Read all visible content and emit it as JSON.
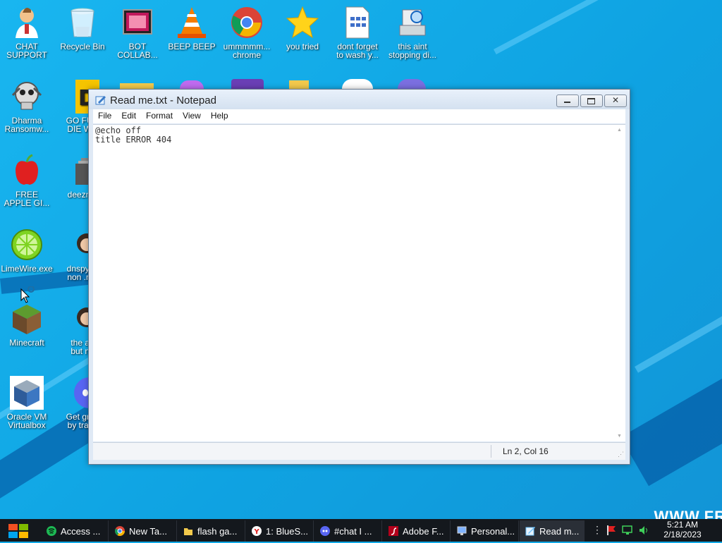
{
  "desktop": {
    "watermark": "WWW.FR",
    "icons": [
      {
        "name": "desktop-icon-chat-support",
        "label": "CHAT\nSUPPORT"
      },
      {
        "name": "desktop-icon-recycle-bin",
        "label": "Recycle Bin"
      },
      {
        "name": "desktop-icon-bot-collab",
        "label": "BOT\nCOLLAB..."
      },
      {
        "name": "desktop-icon-beep-beep",
        "label": "BEEP BEEP"
      },
      {
        "name": "desktop-icon-ummmmm-chrome",
        "label": "ummmmm...\nchrome"
      },
      {
        "name": "desktop-icon-you-tried",
        "label": "you tried"
      },
      {
        "name": "desktop-icon-dont-forget",
        "label": "dont forget\nto wash y..."
      },
      {
        "name": "desktop-icon-this-aint",
        "label": "this aint\nstopping di..."
      },
      {
        "name": "desktop-icon-dharma",
        "label": "Dharma\nRansomw..."
      },
      {
        "name": "desktop-icon-go-fuc",
        "label": "GO FUC\nDIE WH"
      },
      {
        "name": "desktop-icon-free-apple",
        "label": "FREE\nAPPLE GI..."
      },
      {
        "name": "desktop-icon-deeznut",
        "label": "deeznut"
      },
      {
        "name": "desktop-icon-limewire",
        "label": "LimeWire.exe"
      },
      {
        "name": "desktop-icon-dnspy",
        "label": "dnspy bi\nnon .net"
      },
      {
        "name": "desktop-icon-minecraft",
        "label": "Minecraft"
      },
      {
        "name": "desktop-icon-the-ab",
        "label": "the ab\nbut no"
      },
      {
        "name": "desktop-icon-oracle-vm",
        "label": "Oracle VM\nVirtualbox"
      },
      {
        "name": "desktop-icon-get-gro",
        "label": "Get grou\nby trans"
      }
    ]
  },
  "notepad": {
    "title": "Read me.txt - Notepad",
    "menu": [
      "File",
      "Edit",
      "Format",
      "View",
      "Help"
    ],
    "content": "@echo off\ntitle ERROR 404",
    "status_position": "Ln 2, Col 16"
  },
  "taskbar": {
    "items": [
      {
        "label": "Access ...",
        "icon": "spotify-icon",
        "color": "#1db954"
      },
      {
        "label": "New Ta...",
        "icon": "chrome-icon",
        "color": "#db4437"
      },
      {
        "label": "flash ga...",
        "icon": "folder-icon",
        "color": "#f2c94c"
      },
      {
        "label": "1: BlueS...",
        "icon": "yandex-icon",
        "color": "#ffffff"
      },
      {
        "label": "#chat I ...",
        "icon": "discord-icon",
        "color": "#5865f2"
      },
      {
        "label": "Adobe F...",
        "icon": "flash-icon",
        "color": "#b3001b"
      },
      {
        "label": "Personal...",
        "icon": "monitor-icon",
        "color": "#7fb3ff"
      },
      {
        "label": "Read m...",
        "icon": "notepad-icon",
        "color": "#6fc3ff"
      }
    ],
    "clock_time": "5:21 AM",
    "clock_date": "2/18/2023"
  }
}
